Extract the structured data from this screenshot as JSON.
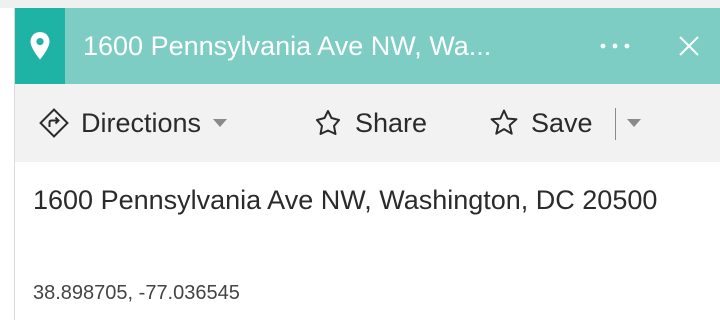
{
  "card": {
    "title": "1600 Pennsylvania Ave NW, Wa...",
    "icons": {
      "location": "location-pin-icon",
      "more": "more-ellipsis-icon",
      "close": "close-icon"
    },
    "colors": {
      "title_bar": "#7dcdc4",
      "pin_box": "#1fb3a5",
      "toolbar_bg": "#f2f2f2",
      "text": "#2b2b2b"
    }
  },
  "toolbar": {
    "directions_label": "Directions",
    "share_label": "Share",
    "save_label": "Save",
    "icons": {
      "directions": "directions-turn-icon",
      "share": "share-icon",
      "save": "star-outline-icon",
      "dropdown": "chevron-down-icon"
    }
  },
  "location": {
    "address": "1600 Pennsylvania Ave NW, Washington, DC 20500",
    "coordinates": "38.898705, -77.036545"
  }
}
